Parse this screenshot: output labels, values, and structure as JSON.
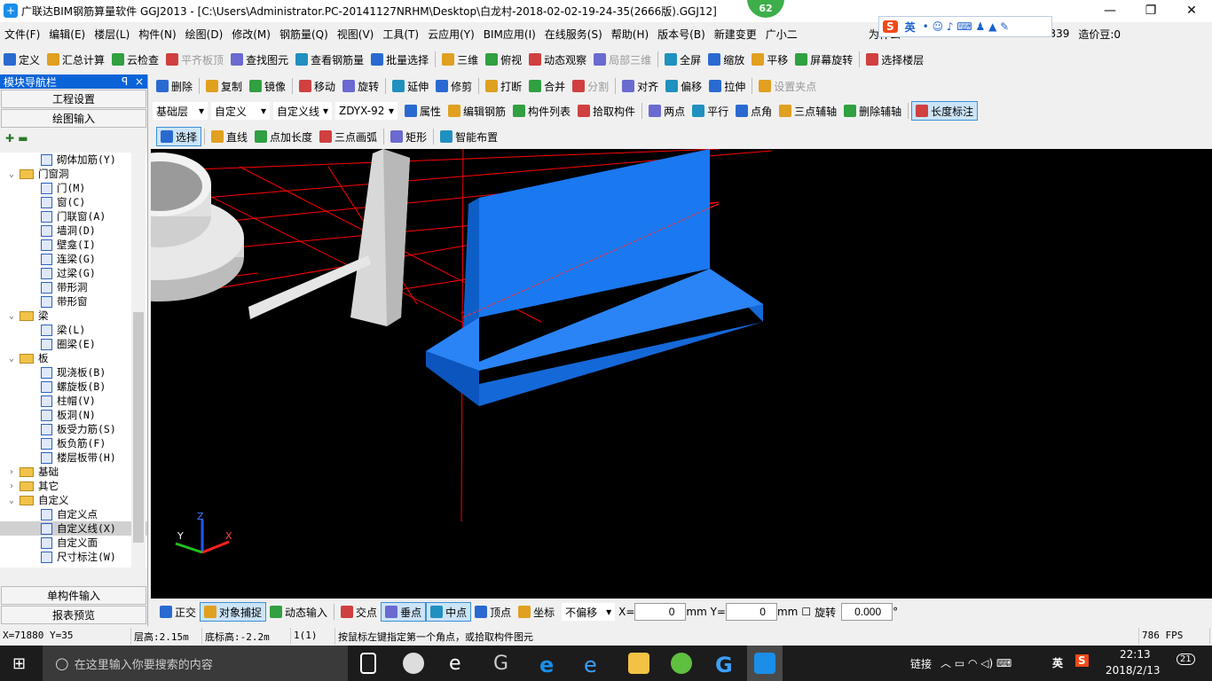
{
  "window": {
    "title": "广联达BIM钢筋算量软件 GGJ2013 - [C:\\Users\\Administrator.PC-20141127NRHM\\Desktop\\白龙村-2018-02-02-19-24-35(2666版).GGJ12]",
    "badge": "62",
    "min": "—",
    "max": "❐",
    "close": "✕"
  },
  "menu": [
    "文件(F)",
    "编辑(E)",
    "楼层(L)",
    "构件(N)",
    "绘图(D)",
    "修改(M)",
    "钢筋量(Q)",
    "视图(V)",
    "工具(T)",
    "云应用(Y)",
    "BIM应用(I)",
    "在线服务(S)",
    "帮助(H)",
    "版本号(B)",
    "新建变更",
    "广小二",
    "为什么",
    "8339",
    "造价豆:0"
  ],
  "ime": {
    "logo": "S",
    "lang": "英"
  },
  "toolbar1": [
    "定义",
    "汇总计算",
    "云检查",
    "平齐板顶",
    "查找图元",
    "查看钢筋量",
    "批量选择",
    "三维",
    "俯视",
    "动态观察",
    "局部三维",
    "全屏",
    "缩放",
    "平移",
    "屏幕旋转",
    "选择楼层"
  ],
  "toolbar2": [
    "删除",
    "复制",
    "镜像",
    "移动",
    "旋转",
    "延伸",
    "修剪",
    "打断",
    "合并",
    "分割",
    "对齐",
    "偏移",
    "拉伸",
    "设置夹点"
  ],
  "toolbar3": {
    "floor": "基础层",
    "category": "自定义",
    "type": "自定义线",
    "component": "ZDYX-92",
    "buttons": [
      "属性",
      "编辑钢筋",
      "构件列表",
      "拾取构件",
      "两点",
      "平行",
      "点角",
      "三点辅轴",
      "删除辅轴",
      "长度标注"
    ]
  },
  "toolbar4": [
    "选择",
    "直线",
    "点加长度",
    "三点画弧",
    "矩形",
    "智能布置"
  ],
  "sidebar": {
    "title": "模块导航栏",
    "pin": "ꟼ",
    "close": "×",
    "buttons": [
      "工程设置",
      "绘图输入"
    ],
    "bottom": [
      "单构件输入",
      "报表预览"
    ],
    "tree": [
      {
        "label": "砌体加筋(Y)",
        "level": 2
      },
      {
        "label": "门窗洞",
        "level": 1,
        "folder": true,
        "open": true
      },
      {
        "label": "门(M)",
        "level": 2
      },
      {
        "label": "窗(C)",
        "level": 2
      },
      {
        "label": "门联窗(A)",
        "level": 2
      },
      {
        "label": "墙洞(D)",
        "level": 2
      },
      {
        "label": "壁龛(I)",
        "level": 2
      },
      {
        "label": "连梁(G)",
        "level": 2
      },
      {
        "label": "过梁(G)",
        "level": 2
      },
      {
        "label": "带形洞",
        "level": 2
      },
      {
        "label": "带形窗",
        "level": 2
      },
      {
        "label": "梁",
        "level": 1,
        "folder": true,
        "open": true
      },
      {
        "label": "梁(L)",
        "level": 2
      },
      {
        "label": "圈梁(E)",
        "level": 2
      },
      {
        "label": "板",
        "level": 1,
        "folder": true,
        "open": true
      },
      {
        "label": "现浇板(B)",
        "level": 2
      },
      {
        "label": "螺旋板(B)",
        "level": 2
      },
      {
        "label": "柱帽(V)",
        "level": 2
      },
      {
        "label": "板洞(N)",
        "level": 2
      },
      {
        "label": "板受力筋(S)",
        "level": 2
      },
      {
        "label": "板负筋(F)",
        "level": 2
      },
      {
        "label": "楼层板带(H)",
        "level": 2
      },
      {
        "label": "基础",
        "level": 1,
        "folder": true,
        "open": false
      },
      {
        "label": "其它",
        "level": 1,
        "folder": true,
        "open": false
      },
      {
        "label": "自定义",
        "level": 1,
        "folder": true,
        "open": true
      },
      {
        "label": "自定义点",
        "level": 2
      },
      {
        "label": "自定义线(X)",
        "level": 2,
        "selected": true
      },
      {
        "label": "自定义面",
        "level": 2
      },
      {
        "label": "尺寸标注(W)",
        "level": 2
      }
    ]
  },
  "bottombar": {
    "buttons": [
      "正交",
      "对象捕捉",
      "动态输入",
      "交点",
      "垂点",
      "中点",
      "顶点",
      "坐标"
    ],
    "offset": "不偏移",
    "x_label": "X=",
    "x": "0",
    "y_label": "mm Y=",
    "y": "0",
    "mm": "mm",
    "rotate": "旋转",
    "angle": "0.000",
    "deg": "°"
  },
  "status": {
    "coords": "X=71880 Y=35",
    "floor_height": "层高:2.15m",
    "base_height": "底标高:-2.2m",
    "count": "1(1)",
    "hint": "按鼠标左键指定第一个角点，或拾取构件图元",
    "fps": "786 FPS"
  },
  "taskbar": {
    "search": "在这里输入你要搜索的内容",
    "link": "链接",
    "lang": "英",
    "time": "22:13",
    "date": "2018/2/13",
    "notif": "21"
  },
  "colors": {
    "accent": "#0a64d8",
    "wall": "#1a74e8",
    "grid": "#ff0000",
    "canvas": "#000000"
  }
}
